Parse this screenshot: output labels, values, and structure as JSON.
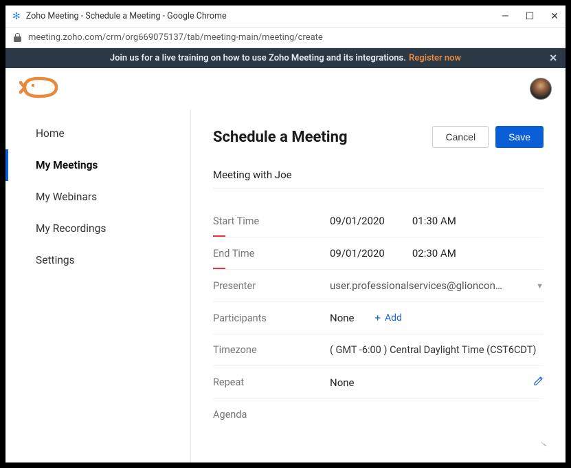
{
  "window": {
    "title": "Zoho Meeting - Schedule a Meeting - Google Chrome",
    "url": "meeting.zoho.com/crm/org669075137/tab/meeting-main/meeting/create"
  },
  "banner": {
    "text": "Join us for a live training on how to use Zoho Meeting and its integrations.",
    "link_text": "Register now"
  },
  "sidebar": {
    "items": [
      {
        "label": "Home",
        "active": false
      },
      {
        "label": "My Meetings",
        "active": true
      },
      {
        "label": "My Webinars",
        "active": false
      },
      {
        "label": "My Recordings",
        "active": false
      },
      {
        "label": "Settings",
        "active": false
      }
    ]
  },
  "main": {
    "title": "Schedule a Meeting",
    "cancel_label": "Cancel",
    "save_label": "Save",
    "meeting_title": "Meeting with Joe",
    "fields": {
      "start_label": "Start Time",
      "start_date": "09/01/2020",
      "start_time": "01:30 AM",
      "end_label": "End Time",
      "end_date": "09/01/2020",
      "end_time": "02:30 AM",
      "presenter_label": "Presenter",
      "presenter_value": "user.professionalservices@glioncon…",
      "participants_label": "Participants",
      "participants_value": "None",
      "participants_add": "Add",
      "timezone_label": "Timezone",
      "timezone_value": "( GMT -6:00 ) Central Daylight Time (CST6CDT)",
      "repeat_label": "Repeat",
      "repeat_value": "None",
      "agenda_label": "Agenda"
    }
  }
}
